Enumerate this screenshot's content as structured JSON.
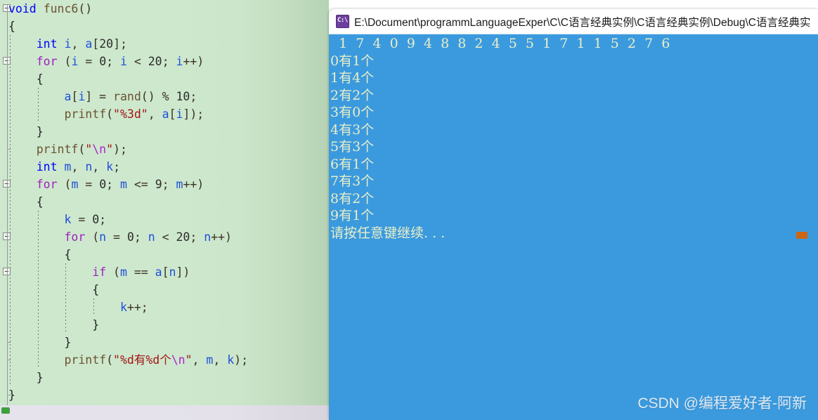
{
  "editor": {
    "language": "c",
    "background_color": "#cde8cd",
    "code_lines": [
      {
        "indent": 0,
        "fold": "open-start",
        "tokens": [
          {
            "t": "void",
            "c": "k-type"
          },
          {
            "t": " ",
            "c": "plain"
          },
          {
            "t": "func6",
            "c": "fn"
          },
          {
            "t": "()",
            "c": "plain"
          }
        ]
      },
      {
        "indent": 0,
        "fold": "line",
        "tokens": [
          {
            "t": "{",
            "c": "brace"
          }
        ]
      },
      {
        "indent": 1,
        "fold": "line",
        "tokens": [
          {
            "t": "int",
            "c": "k-type"
          },
          {
            "t": " ",
            "c": "plain"
          },
          {
            "t": "i",
            "c": "var"
          },
          {
            "t": ", ",
            "c": "plain"
          },
          {
            "t": "a",
            "c": "var"
          },
          {
            "t": "[",
            "c": "plain"
          },
          {
            "t": "20",
            "c": "num"
          },
          {
            "t": "];",
            "c": "plain"
          }
        ]
      },
      {
        "indent": 1,
        "fold": "open",
        "tokens": [
          {
            "t": "for",
            "c": "k-flow"
          },
          {
            "t": " (",
            "c": "plain"
          },
          {
            "t": "i",
            "c": "var"
          },
          {
            "t": " = ",
            "c": "plain"
          },
          {
            "t": "0",
            "c": "num"
          },
          {
            "t": "; ",
            "c": "plain"
          },
          {
            "t": "i",
            "c": "var"
          },
          {
            "t": " < ",
            "c": "plain"
          },
          {
            "t": "20",
            "c": "num"
          },
          {
            "t": "; ",
            "c": "plain"
          },
          {
            "t": "i",
            "c": "var"
          },
          {
            "t": "++)",
            "c": "plain"
          }
        ]
      },
      {
        "indent": 1,
        "fold": "line",
        "tokens": [
          {
            "t": "{",
            "c": "brace"
          }
        ]
      },
      {
        "indent": 2,
        "fold": "line",
        "tokens": [
          {
            "t": "a",
            "c": "var"
          },
          {
            "t": "[",
            "c": "plain"
          },
          {
            "t": "i",
            "c": "var"
          },
          {
            "t": "] = ",
            "c": "plain"
          },
          {
            "t": "rand",
            "c": "fn"
          },
          {
            "t": "() % ",
            "c": "plain"
          },
          {
            "t": "10",
            "c": "num"
          },
          {
            "t": ";",
            "c": "plain"
          }
        ]
      },
      {
        "indent": 2,
        "fold": "line",
        "tokens": [
          {
            "t": "printf",
            "c": "fn"
          },
          {
            "t": "(",
            "c": "plain"
          },
          {
            "t": "\"%3d\"",
            "c": "str"
          },
          {
            "t": ", ",
            "c": "plain"
          },
          {
            "t": "a",
            "c": "var"
          },
          {
            "t": "[",
            "c": "plain"
          },
          {
            "t": "i",
            "c": "var"
          },
          {
            "t": "]);",
            "c": "plain"
          }
        ]
      },
      {
        "indent": 1,
        "fold": "line",
        "tokens": [
          {
            "t": "}",
            "c": "brace"
          }
        ]
      },
      {
        "indent": 1,
        "fold": "tick",
        "tokens": [
          {
            "t": "printf",
            "c": "fn"
          },
          {
            "t": "(",
            "c": "plain"
          },
          {
            "t": "\"",
            "c": "str"
          },
          {
            "t": "\\n",
            "c": "esc"
          },
          {
            "t": "\"",
            "c": "str"
          },
          {
            "t": ");",
            "c": "plain"
          }
        ]
      },
      {
        "indent": 1,
        "fold": "line",
        "tokens": [
          {
            "t": "int",
            "c": "k-type"
          },
          {
            "t": " ",
            "c": "plain"
          },
          {
            "t": "m",
            "c": "var"
          },
          {
            "t": ", ",
            "c": "plain"
          },
          {
            "t": "n",
            "c": "var"
          },
          {
            "t": ", ",
            "c": "plain"
          },
          {
            "t": "k",
            "c": "var"
          },
          {
            "t": ";",
            "c": "plain"
          }
        ]
      },
      {
        "indent": 1,
        "fold": "open",
        "tokens": [
          {
            "t": "for",
            "c": "k-flow"
          },
          {
            "t": " (",
            "c": "plain"
          },
          {
            "t": "m",
            "c": "var"
          },
          {
            "t": " = ",
            "c": "plain"
          },
          {
            "t": "0",
            "c": "num"
          },
          {
            "t": "; ",
            "c": "plain"
          },
          {
            "t": "m",
            "c": "var"
          },
          {
            "t": " <= ",
            "c": "plain"
          },
          {
            "t": "9",
            "c": "num"
          },
          {
            "t": "; ",
            "c": "plain"
          },
          {
            "t": "m",
            "c": "var"
          },
          {
            "t": "++)",
            "c": "plain"
          }
        ]
      },
      {
        "indent": 1,
        "fold": "line",
        "tokens": [
          {
            "t": "{",
            "c": "brace"
          }
        ]
      },
      {
        "indent": 2,
        "fold": "line",
        "tokens": [
          {
            "t": "k",
            "c": "var"
          },
          {
            "t": " = ",
            "c": "plain"
          },
          {
            "t": "0",
            "c": "num"
          },
          {
            "t": ";",
            "c": "plain"
          }
        ]
      },
      {
        "indent": 2,
        "fold": "open",
        "tokens": [
          {
            "t": "for",
            "c": "k-flow"
          },
          {
            "t": " (",
            "c": "plain"
          },
          {
            "t": "n",
            "c": "var"
          },
          {
            "t": " = ",
            "c": "plain"
          },
          {
            "t": "0",
            "c": "num"
          },
          {
            "t": "; ",
            "c": "plain"
          },
          {
            "t": "n",
            "c": "var"
          },
          {
            "t": " < ",
            "c": "plain"
          },
          {
            "t": "20",
            "c": "num"
          },
          {
            "t": "; ",
            "c": "plain"
          },
          {
            "t": "n",
            "c": "var"
          },
          {
            "t": "++)",
            "c": "plain"
          }
        ]
      },
      {
        "indent": 2,
        "fold": "line",
        "tokens": [
          {
            "t": "{",
            "c": "brace"
          }
        ]
      },
      {
        "indent": 3,
        "fold": "open",
        "tokens": [
          {
            "t": "if",
            "c": "k-flow"
          },
          {
            "t": " (",
            "c": "plain"
          },
          {
            "t": "m",
            "c": "var"
          },
          {
            "t": " == ",
            "c": "plain"
          },
          {
            "t": "a",
            "c": "var"
          },
          {
            "t": "[",
            "c": "plain"
          },
          {
            "t": "n",
            "c": "var"
          },
          {
            "t": "])",
            "c": "plain"
          }
        ]
      },
      {
        "indent": 3,
        "fold": "line",
        "tokens": [
          {
            "t": "{",
            "c": "brace"
          }
        ]
      },
      {
        "indent": 4,
        "fold": "line",
        "tokens": [
          {
            "t": "k",
            "c": "var"
          },
          {
            "t": "++;",
            "c": "plain"
          }
        ]
      },
      {
        "indent": 3,
        "fold": "line",
        "tokens": [
          {
            "t": "}",
            "c": "brace"
          }
        ]
      },
      {
        "indent": 2,
        "fold": "tick",
        "tokens": [
          {
            "t": "}",
            "c": "brace"
          }
        ]
      },
      {
        "indent": 2,
        "fold": "tick",
        "tokens": [
          {
            "t": "printf",
            "c": "fn"
          },
          {
            "t": "(",
            "c": "plain"
          },
          {
            "t": "\"%d有%d个",
            "c": "str"
          },
          {
            "t": "\\n",
            "c": "esc"
          },
          {
            "t": "\"",
            "c": "str"
          },
          {
            "t": ", ",
            "c": "plain"
          },
          {
            "t": "m",
            "c": "var"
          },
          {
            "t": ", ",
            "c": "plain"
          },
          {
            "t": "k",
            "c": "var"
          },
          {
            "t": ");",
            "c": "plain"
          }
        ]
      },
      {
        "indent": 1,
        "fold": "line",
        "tokens": [
          {
            "t": "}",
            "c": "brace"
          }
        ]
      },
      {
        "indent": 0,
        "fold": "end",
        "tokens": [
          {
            "t": "}",
            "c": "brace"
          }
        ]
      }
    ]
  },
  "console": {
    "title": "E:\\Document\\programmLanguageExper\\C\\C语言经典实例\\C语言经典实例\\Debug\\C语言经典实",
    "icon": "console-app-icon",
    "background_color": "#3b9ade",
    "text_color": "#e8eec8",
    "array_values": [
      1,
      7,
      4,
      0,
      9,
      4,
      8,
      8,
      2,
      4,
      5,
      5,
      1,
      7,
      1,
      1,
      5,
      2,
      7,
      6
    ],
    "array_line": "  1  7  4  0  9  4  8  8  2  4  5  5  1  7  1  1  5  2  7  6",
    "count_lines": [
      "0有1个",
      "1有4个",
      "2有2个",
      "3有0个",
      "4有3个",
      "5有3个",
      "6有1个",
      "7有3个",
      "8有2个",
      "9有1个"
    ],
    "prompt_line": "请按任意键继续. . .",
    "cursor_color": "#cc6615"
  },
  "watermark": {
    "text": "CSDN @编程爱好者-阿新"
  }
}
